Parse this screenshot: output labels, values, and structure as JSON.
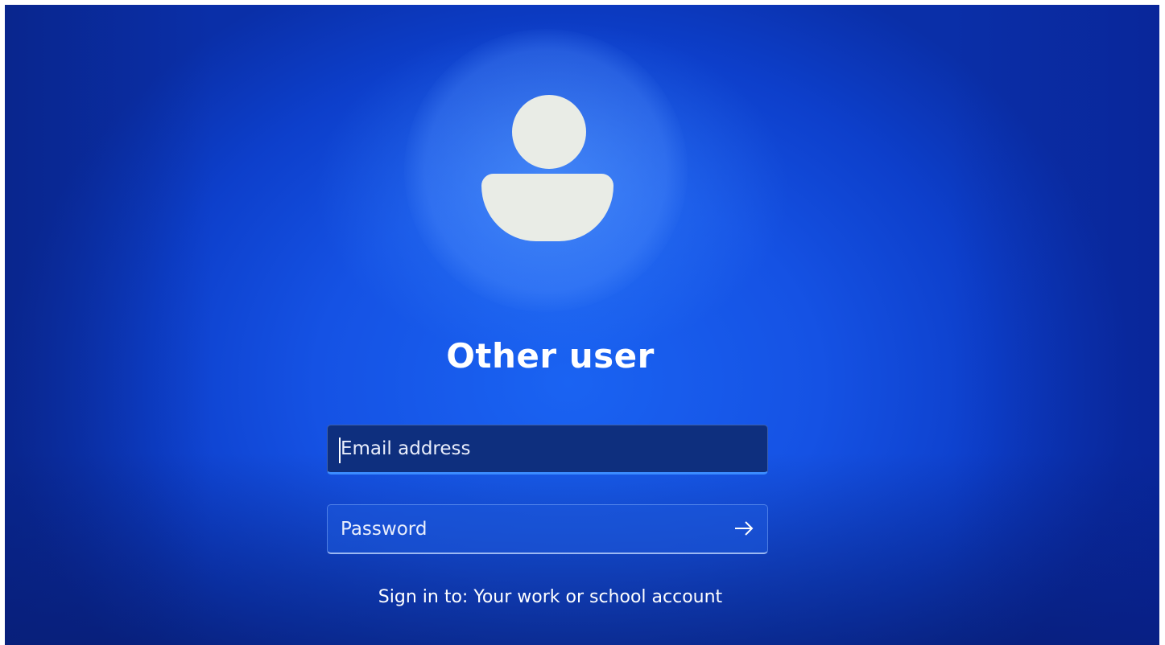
{
  "login": {
    "title": "Other user",
    "email_placeholder": "Email address",
    "password_placeholder": "Password",
    "sign_in_note": "Sign in to: Your work or school account"
  },
  "icons": {
    "avatar": "user-avatar-icon",
    "submit": "arrow-right-icon"
  },
  "colors": {
    "background": "#1552e4",
    "avatar": "#e9ece6",
    "email_field_bg": "#0e2f7e",
    "focus_accent": "#3b8cff"
  }
}
